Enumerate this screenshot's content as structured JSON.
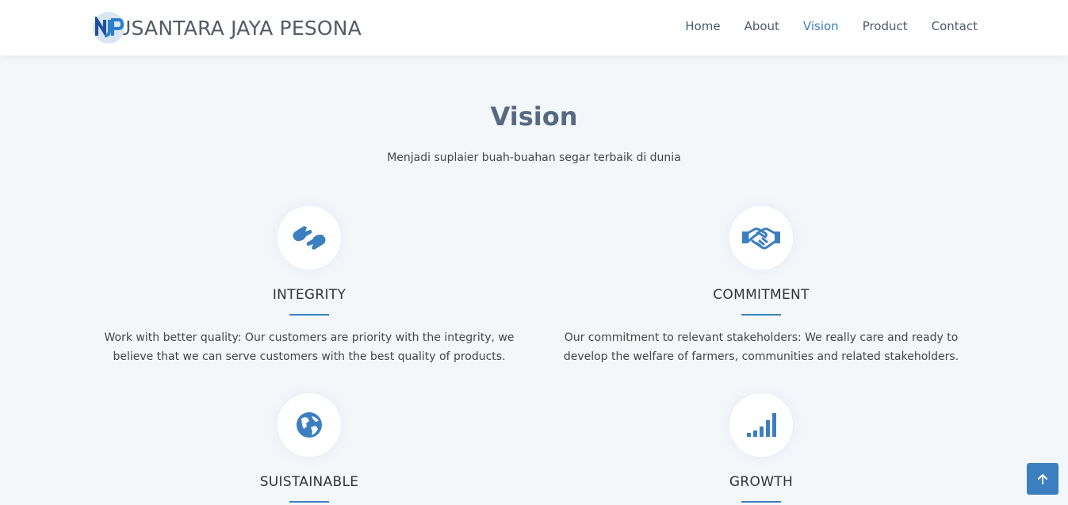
{
  "brand": {
    "name": "USANTARA JAYA PESONA",
    "logo_mark": "NJP"
  },
  "nav": {
    "items": [
      {
        "label": "Home"
      },
      {
        "label": "About"
      },
      {
        "label": "Vision",
        "active": true
      },
      {
        "label": "Product"
      },
      {
        "label": "Contact"
      }
    ]
  },
  "section": {
    "title": "Vision",
    "subtitle": "Menjadi suplaier buah-buahan segar terbaik di dunia"
  },
  "values": [
    {
      "icon": "hands-icon",
      "title": "INTEGRITY",
      "text": "Work with better quality: Our customers are priority with the integrity, we believe that we can serve customers with the best quality of products."
    },
    {
      "icon": "handshake-icon",
      "title": "COMMITMENT",
      "text": "Our commitment to relevant stakeholders: We really care and ready to develop the welfare of farmers, communities and related stakeholders."
    },
    {
      "icon": "globe-icon",
      "title": "SUISTAINABLE",
      "text": ""
    },
    {
      "icon": "signal-bars-icon",
      "title": "GROWTH",
      "text": ""
    }
  ],
  "back_to_top": {
    "icon": "arrow-up-icon"
  },
  "colors": {
    "accent": "#3b7fc0",
    "background": "#f4f7fa",
    "title": "#566a84"
  }
}
